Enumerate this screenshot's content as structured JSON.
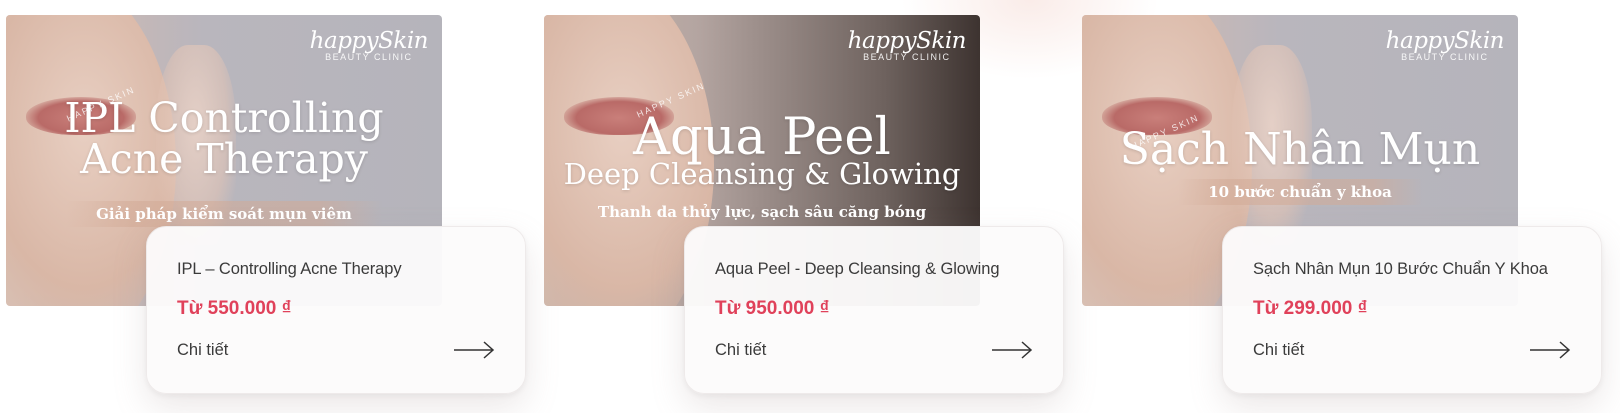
{
  "brand": {
    "logo_text": "happySkin",
    "logo_sub": "BEAUTY CLINIC",
    "stamp": "HAPPY SKIN"
  },
  "colors": {
    "price": "#e0415a",
    "text": "#3b3b3b",
    "card_bg": "#fcfbfb"
  },
  "icons": {
    "detail_arrow": "arrow-right-icon"
  },
  "services": [
    {
      "banner_line1": "IPL Controlling",
      "banner_line2": "Acne Therapy",
      "banner_tagline": "Giải pháp kiểm soát mụn viêm",
      "title": "IPL – Controlling Acne Therapy",
      "price": "Từ 550.000 ₫",
      "detail_label": "Chi tiết"
    },
    {
      "banner_line1": "Aqua Peel",
      "banner_line2": "Deep Cleansing & Glowing",
      "banner_tagline": "Thanh da thủy lực, sạch sâu căng bóng",
      "title": "Aqua Peel - Deep Cleansing & Glowing",
      "price": "Từ 950.000 ₫",
      "detail_label": "Chi tiết"
    },
    {
      "banner_line1": "Sạch Nhân Mụn",
      "banner_tagline": "10 bước chuẩn y khoa",
      "title": "Sạch Nhân Mụn 10 Bước Chuẩn Y Khoa",
      "price": "Từ 299.000 ₫",
      "detail_label": "Chi tiết"
    }
  ]
}
